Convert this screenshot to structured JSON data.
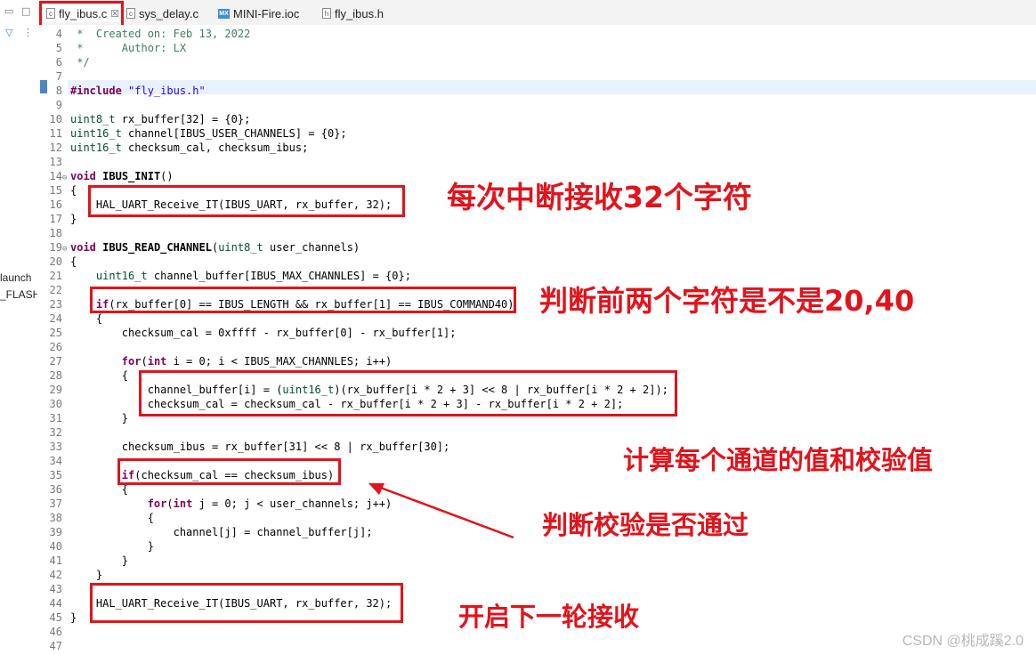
{
  "side_panel": {
    "items": [
      "launch",
      "_FLASH"
    ]
  },
  "tabs": [
    {
      "label": "fly_ibus.c",
      "close": "☒",
      "icon": "c-file-icon"
    },
    {
      "label": "sys_delay.c",
      "icon": "c-file-icon"
    },
    {
      "label": "MINI-Fire.ioc",
      "icon": "mx-file-icon"
    },
    {
      "label": "fly_ibus.h",
      "icon": "h-file-icon"
    }
  ],
  "lines": [
    {
      "n": "4",
      "html": "<span class=\"cmt\"> *  Created on: Feb 13, 2022</span>"
    },
    {
      "n": "5",
      "html": "<span class=\"cmt\"> *      Author: LX</span>"
    },
    {
      "n": "6",
      "html": "<span class=\"cmt\"> */</span>"
    },
    {
      "n": "7",
      "html": ""
    },
    {
      "n": "8",
      "html": "<span class=\"kw\">#include</span> <span class=\"str\">\"fly_ibus.h\"</span>"
    },
    {
      "n": "9",
      "html": ""
    },
    {
      "n": "10",
      "html": "<span class=\"typ\">uint8_t</span> rx_buffer[32] = {0};"
    },
    {
      "n": "11",
      "html": "<span class=\"typ\">uint16_t</span> channel[IBUS_USER_CHANNELS] = {0};"
    },
    {
      "n": "12",
      "html": "<span class=\"typ\">uint16_t</span> checksum_cal, checksum_ibus;"
    },
    {
      "n": "13",
      "html": ""
    },
    {
      "n": "14",
      "fold": "⊖",
      "html": "<span class=\"kw\">void</span> <b>IBUS_INIT</b>()"
    },
    {
      "n": "15",
      "html": "{"
    },
    {
      "n": "16",
      "html": "    HAL_UART_Receive_IT(IBUS_UART, rx_buffer, 32);"
    },
    {
      "n": "17",
      "html": "}"
    },
    {
      "n": "18",
      "html": ""
    },
    {
      "n": "19",
      "fold": "⊖",
      "html": "<span class=\"kw\">void</span> <b>IBUS_READ_CHANNEL</b>(<span class=\"typ\">uint8_t</span> user_channels)"
    },
    {
      "n": "20",
      "html": "{"
    },
    {
      "n": "21",
      "html": "    <span class=\"typ\">uint16_t</span> channel_buffer[IBUS_MAX_CHANNLES] = {0};"
    },
    {
      "n": "22",
      "html": ""
    },
    {
      "n": "23",
      "html": "    <span class=\"kw\">if</span>(rx_buffer[0] == IBUS_LENGTH &amp;&amp; rx_buffer[1] == IBUS_COMMAND40)"
    },
    {
      "n": "24",
      "html": "    {"
    },
    {
      "n": "25",
      "html": "        checksum_cal = 0xffff - rx_buffer[0] - rx_buffer[1];"
    },
    {
      "n": "26",
      "html": ""
    },
    {
      "n": "27",
      "html": "        <span class=\"kw\">for</span>(<span class=\"kw\">int</span> i = 0; i &lt; IBUS_MAX_CHANNLES; i++)"
    },
    {
      "n": "28",
      "html": "        {"
    },
    {
      "n": "29",
      "html": "            channel_buffer[i] = (<span class=\"typ\">uint16_t</span>)(rx_buffer[i * 2 + 3] &lt;&lt; 8 | rx_buffer[i * 2 + 2]);"
    },
    {
      "n": "30",
      "html": "            checksum_cal = checksum_cal - rx_buffer[i * 2 + 3] - rx_buffer[i * 2 + 2];"
    },
    {
      "n": "31",
      "html": "        }"
    },
    {
      "n": "32",
      "html": ""
    },
    {
      "n": "33",
      "html": "        checksum_ibus = rx_buffer[31] &lt;&lt; 8 | rx_buffer[30];"
    },
    {
      "n": "34",
      "html": ""
    },
    {
      "n": "35",
      "html": "        <span class=\"kw\">if</span>(checksum_cal == checksum_ibus)"
    },
    {
      "n": "36",
      "html": "        {"
    },
    {
      "n": "37",
      "html": "            <span class=\"kw\">for</span>(<span class=\"kw\">int</span> j = 0; j &lt; user_channels; j++)"
    },
    {
      "n": "38",
      "html": "            {"
    },
    {
      "n": "39",
      "html": "                channel[j] = channel_buffer[j];"
    },
    {
      "n": "40",
      "html": "            }"
    },
    {
      "n": "41",
      "html": "        }"
    },
    {
      "n": "42",
      "html": "    }"
    },
    {
      "n": "43",
      "html": ""
    },
    {
      "n": "44",
      "html": "    HAL_UART_Receive_IT(IBUS_UART, rx_buffer, 32);"
    },
    {
      "n": "45",
      "html": "}"
    },
    {
      "n": "46",
      "html": ""
    },
    {
      "n": "47",
      "html": ""
    }
  ],
  "annotations": {
    "note1": "每次中断接收32个字符",
    "note2": "判断前两个字符是不是20,40",
    "note3": "计算每个通道的值和校验值",
    "note4": "判断校验是否通过",
    "note5": "开启下一轮接收"
  },
  "colors": {
    "annotation": "#e3131b",
    "keyword": "#7f0055",
    "comment": "#3f7f5f",
    "string": "#2a00ff",
    "type": "#005032"
  },
  "watermark": "CSDN @桃成蹊2.0"
}
